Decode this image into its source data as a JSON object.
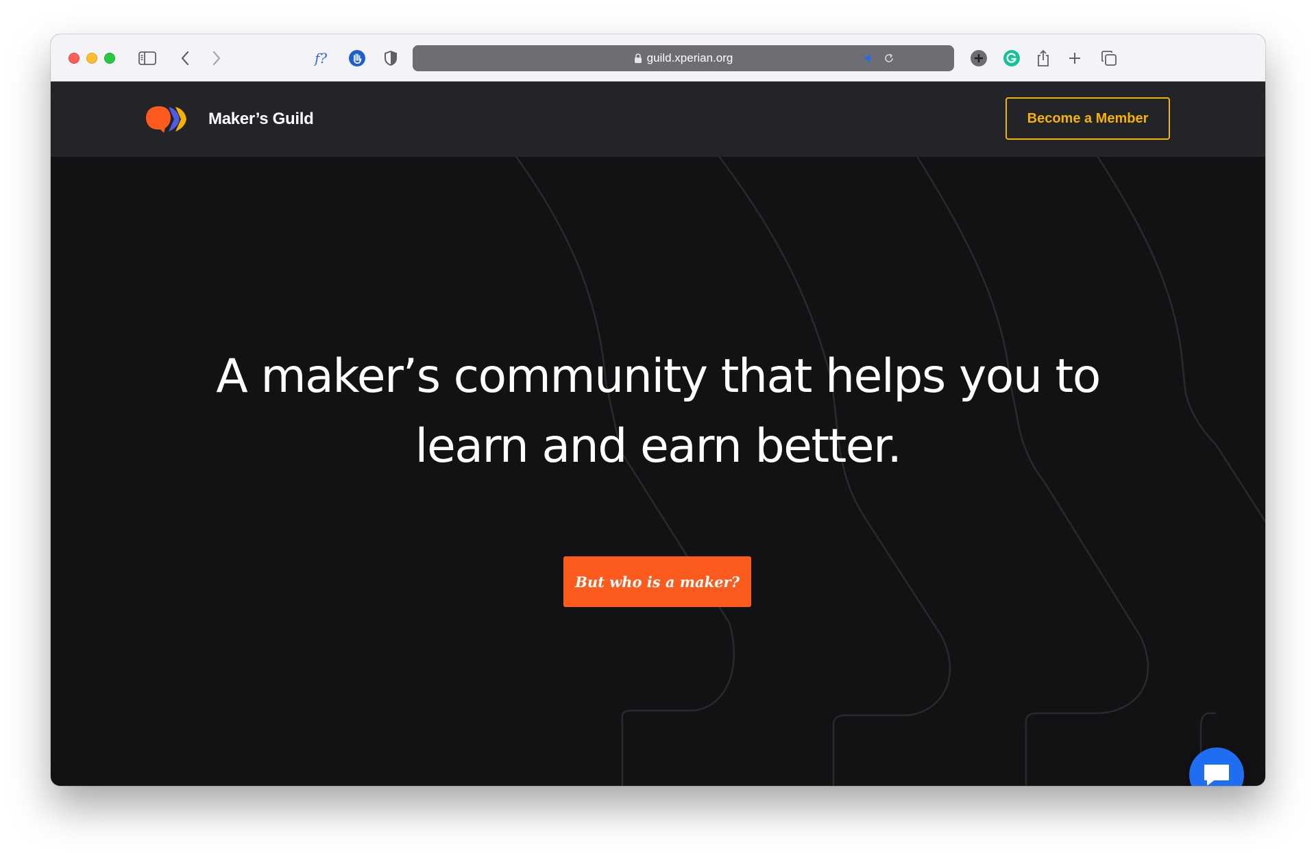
{
  "browser": {
    "url": "guild.xperian.org",
    "icons": {
      "sidebar": "sidebar-icon",
      "back": "chevron-left-icon",
      "forward": "chevron-right-icon",
      "extension_font": "font-question-icon",
      "extension_hand": "hand-icon",
      "extension_shield": "shield-icon",
      "lock": "lock-icon",
      "audio": "speaker-icon",
      "reload": "reload-icon",
      "extension_plus": "plus-circle-icon",
      "grammarly": "grammarly-icon",
      "share": "share-icon",
      "new_tab": "plus-icon",
      "tab_overview": "tabs-icon"
    }
  },
  "header": {
    "brand_name": "Maker’s Guild",
    "cta_label": "Become a Member",
    "colors": {
      "accent": "#f5b300",
      "background": "#232428",
      "logo_orange": "#fd5a1e",
      "logo_blue": "#4d5be8",
      "logo_yellow": "#f5b300"
    }
  },
  "hero": {
    "headline_line1": "A maker’s community that helps you to",
    "headline_line2": "learn and earn better.",
    "cta_label": "But who is a maker?",
    "colors": {
      "background": "#121214",
      "cta": "#fd5a1e"
    }
  },
  "chat": {
    "icon": "chat-icon",
    "color": "#1f6df0"
  }
}
